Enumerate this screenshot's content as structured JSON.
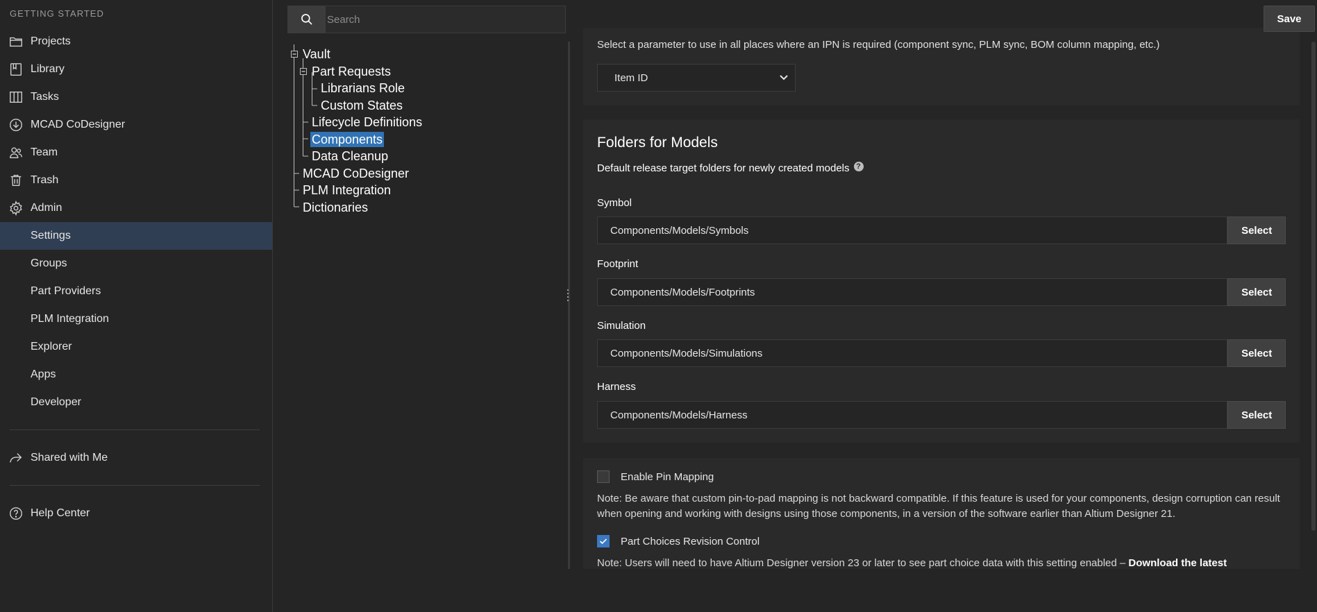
{
  "sidebar": {
    "heading": "GETTING STARTED",
    "main_items": [
      {
        "label": "Projects",
        "icon": "folder-icon"
      },
      {
        "label": "Library",
        "icon": "library-icon"
      },
      {
        "label": "Tasks",
        "icon": "tasks-icon"
      },
      {
        "label": "MCAD CoDesigner",
        "icon": "download-circle-icon"
      },
      {
        "label": "Team",
        "icon": "team-icon"
      },
      {
        "label": "Trash",
        "icon": "trash-icon"
      },
      {
        "label": "Admin",
        "icon": "gear-icon"
      }
    ],
    "admin_items": [
      "Settings",
      "Groups",
      "Part Providers",
      "PLM Integration",
      "Explorer",
      "Apps",
      "Developer"
    ],
    "active_item": "Settings",
    "shared": "Shared with Me",
    "help": "Help Center"
  },
  "search": {
    "placeholder": "Search"
  },
  "tree": [
    {
      "label": "Vault",
      "level": 0
    },
    {
      "label": "Part Requests",
      "level": 1
    },
    {
      "label": "Librarians Role",
      "level": 2
    },
    {
      "label": "Custom States",
      "level": 2
    },
    {
      "label": "Lifecycle Definitions",
      "level": 1
    },
    {
      "label": "Components",
      "level": 1,
      "selected": true
    },
    {
      "label": "Data Cleanup",
      "level": 1
    },
    {
      "label": "MCAD CoDesigner",
      "level": 0
    },
    {
      "label": "PLM Integration",
      "level": 0
    },
    {
      "label": "Dictionaries",
      "level": 0
    }
  ],
  "toolbar": {
    "save_label": "Save"
  },
  "ipn": {
    "description": "Select a parameter to use in all places where an IPN is required (component sync, PLM sync, BOM column mapping, etc.)",
    "selected": "Item ID"
  },
  "folders": {
    "title": "Folders for Models",
    "subtitle": "Default release target folders for newly created models",
    "help_glyph": "?",
    "select_label": "Select",
    "fields": [
      {
        "label": "Symbol",
        "value": "Components/Models/Symbols"
      },
      {
        "label": "Footprint",
        "value": "Components/Models/Footprints"
      },
      {
        "label": "Simulation",
        "value": "Components/Models/Simulations"
      },
      {
        "label": "Harness",
        "value": "Components/Models/Harness"
      }
    ]
  },
  "options": {
    "pin_mapping": {
      "label": "Enable Pin Mapping",
      "checked": false,
      "note": "Note: Be aware that custom pin-to-pad mapping is not backward compatible. If this feature is used for your components, design corruption can result when opening and working with designs using those components, in a version of the software earlier than Altium Designer 21."
    },
    "part_choices": {
      "label": "Part Choices Revision Control",
      "checked": true,
      "note": "Note: Users will need to have Altium Designer version 23 or later to see part choice data with this setting enabled – ",
      "link": "Download the latest"
    }
  },
  "colors": {
    "background": "#252526",
    "card": "#2a2a2b",
    "active_nav": "#2f3e52",
    "selection": "#3173b5",
    "checkbox_on": "#3b79c3"
  }
}
